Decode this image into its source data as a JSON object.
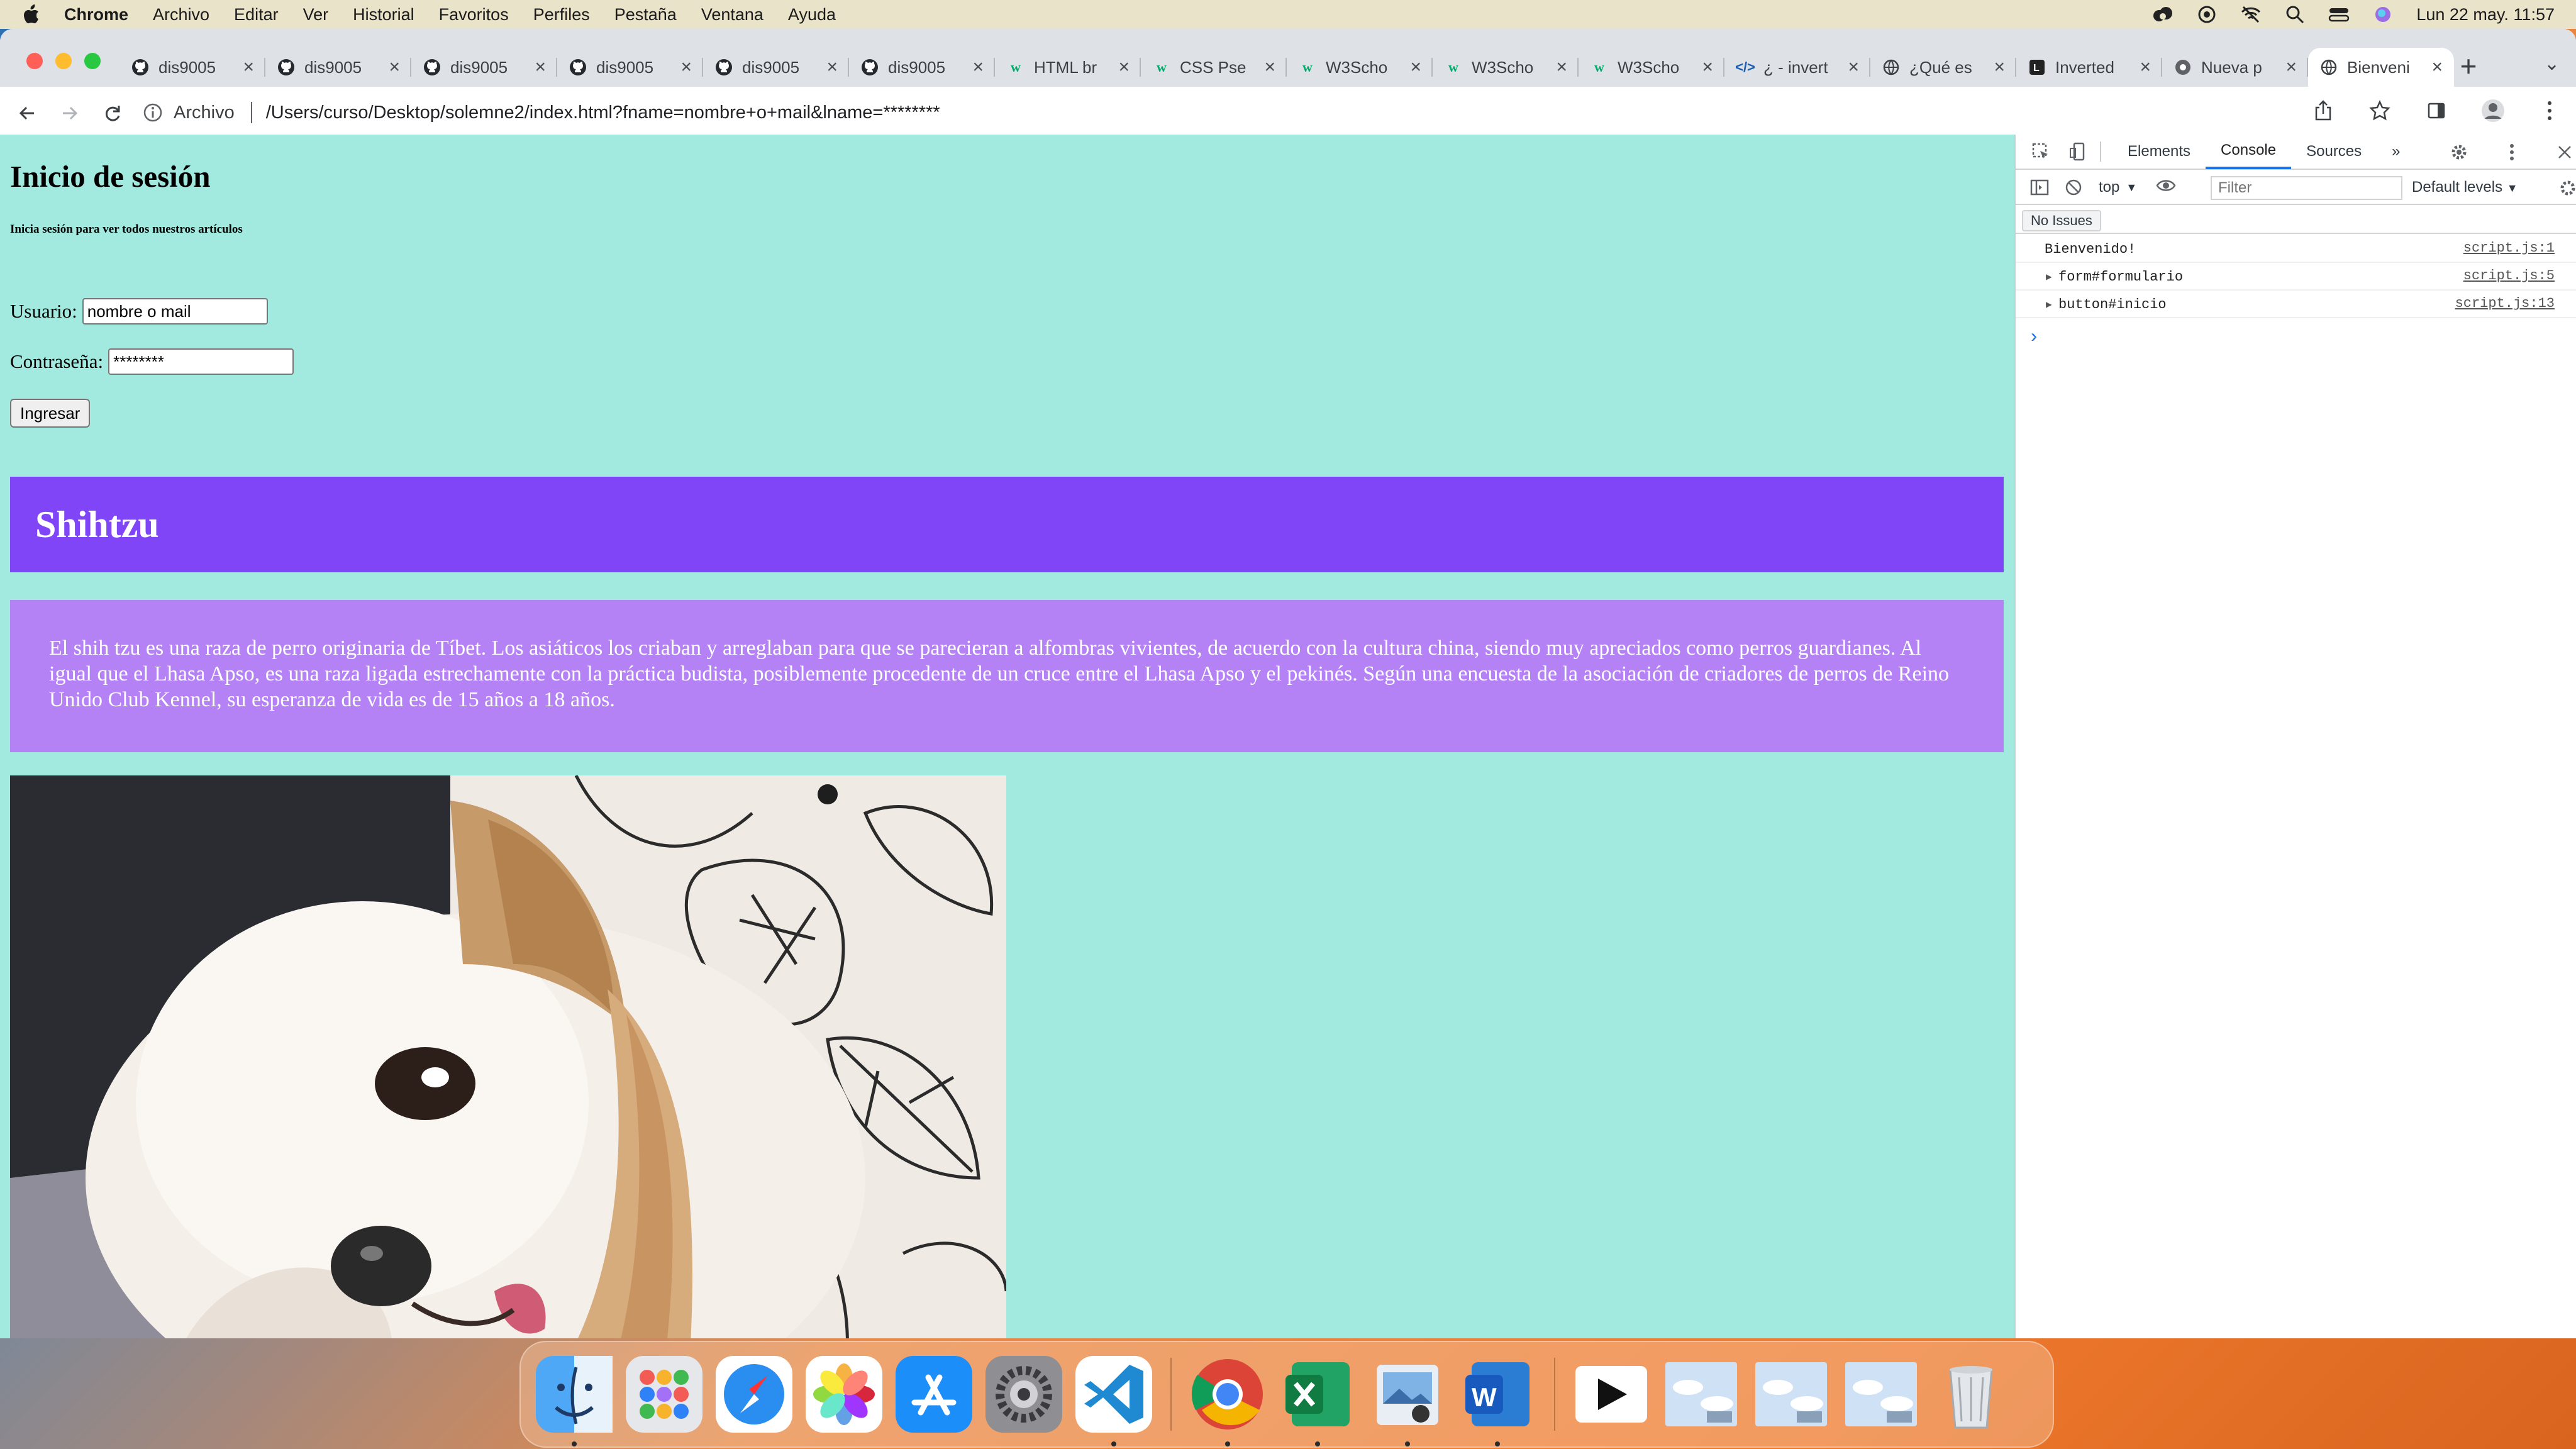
{
  "menubar": {
    "app": "Chrome",
    "items": [
      "Archivo",
      "Editar",
      "Ver",
      "Historial",
      "Favoritos",
      "Perfiles",
      "Pestaña",
      "Ventana",
      "Ayuda"
    ],
    "clock": "Lun 22 may.  11:57"
  },
  "browser": {
    "tabs": [
      {
        "label": "dis9005",
        "icon": "github-icon"
      },
      {
        "label": "dis9005",
        "icon": "github-icon"
      },
      {
        "label": "dis9005",
        "icon": "github-icon"
      },
      {
        "label": "dis9005",
        "icon": "github-icon"
      },
      {
        "label": "dis9005",
        "icon": "github-icon"
      },
      {
        "label": "dis9005",
        "icon": "github-icon"
      },
      {
        "label": "HTML br",
        "icon": "w3schools-icon"
      },
      {
        "label": "CSS Pse",
        "icon": "w3schools-icon"
      },
      {
        "label": "W3Scho",
        "icon": "w3schools-icon"
      },
      {
        "label": "W3Scho",
        "icon": "w3schools-icon"
      },
      {
        "label": "W3Scho",
        "icon": "w3schools-icon"
      },
      {
        "label": "¿ - invert",
        "icon": "code-icon"
      },
      {
        "label": "¿Qué es",
        "icon": "globe-icon"
      },
      {
        "label": "Inverted",
        "icon": "letter-icon"
      },
      {
        "label": "Nueva p",
        "icon": "chrome-icon"
      },
      {
        "label": "Bienveni",
        "icon": "globe-icon",
        "active": true
      }
    ],
    "address": {
      "scheme_label": "Archivo",
      "url": "/Users/curso/Desktop/solemne2/index.html?fname=nombre+o+mail&lname=********"
    }
  },
  "page": {
    "title": "Inicio de sesión",
    "subtitle": "Inicia sesión para ver todos nuestros artículos",
    "user_label": "Usuario:",
    "user_value": "nombre o mail",
    "pass_label": "Contraseña:",
    "pass_value": "********",
    "login_button": "Ingresar",
    "banner_title": "Shihtzu",
    "description": "El shih tzu es una raza de perro originaria de Tíbet. Los asiáticos los criaban y arreglaban para que se parecieran a alfombras vivientes, de acuerdo con la cultura china, siendo muy apreciados como perros guardianes. Al igual que el Lhasa Apso, es una raza ligada estrechamente con la práctica budista, posiblemente procedente de un cruce entre el Lhasa Apso y el pekinés. Según una encuesta de la asociación de criadores de perros de Reino Unido Club Kennel, su esperanza de vida es de 15 años a 18 años.",
    "colors": {
      "background": "#a2eadf",
      "banner": "#8145f8",
      "description_bg": "#b582f5"
    }
  },
  "devtools": {
    "tabs": [
      "Elements",
      "Console",
      "Sources"
    ],
    "active_tab": "Console",
    "context": "top",
    "filter_placeholder": "Filter",
    "levels": "Default levels",
    "issues": "No Issues",
    "logs": [
      {
        "message": "Bienvenido!",
        "source": "script.js:1",
        "expandable": false
      },
      {
        "message": "form#formulario",
        "source": "script.js:5",
        "expandable": true
      },
      {
        "message": "button#inicio",
        "source": "script.js:13",
        "expandable": true
      }
    ]
  },
  "dock": {
    "items": [
      "finder-icon",
      "launchpad-icon",
      "safari-icon",
      "photos-icon",
      "app-store-icon",
      "system-settings-icon",
      "vscode-icon",
      "chrome-icon",
      "excel-icon",
      "preview-icon",
      "word-icon",
      "youtube-window-icon",
      "window-thumbnail-icon",
      "window-thumbnail-icon",
      "window-thumbnail-icon",
      "trash-icon"
    ]
  }
}
